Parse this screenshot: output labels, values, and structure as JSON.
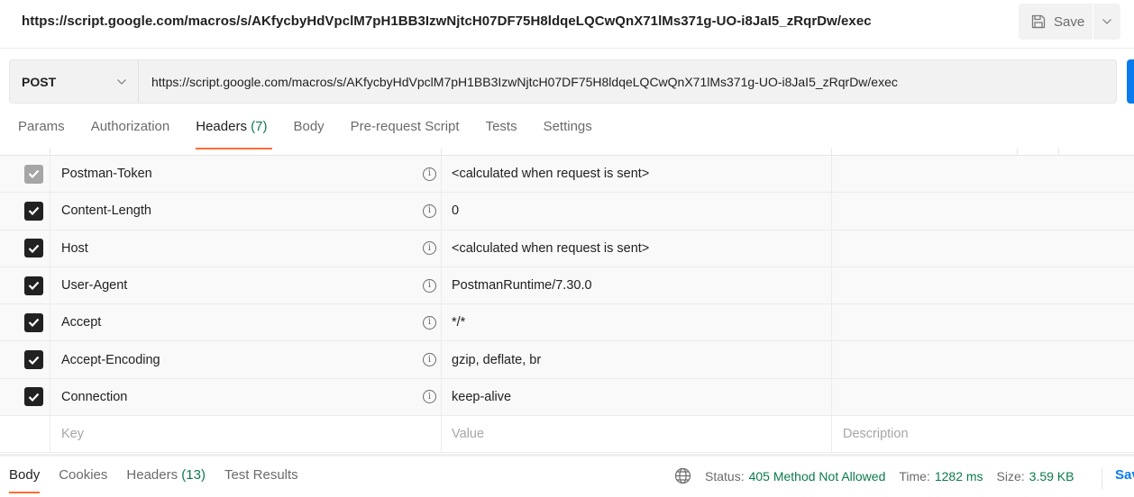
{
  "window": {
    "title_url": "https://script.google.com/macros/s/AKfycbyHdVpclM7pH1BB3IzwNjtcH07DF75H8ldqeLQCwQnX71lMs371g-UO-i8JaI5_zRqrDw/exec",
    "save_label": "Save",
    "save_icon": "floppy-disk-icon",
    "save_menu_icon": "chevron-down-icon"
  },
  "request": {
    "method": "POST",
    "method_icon": "chevron-down-icon",
    "url": "https://script.google.com/macros/s/AKfycbyHdVpclM7pH1BB3IzwNjtcH07DF75H8ldqeLQCwQnX71lMs371g-UO-i8JaI5_zRqrDw/exec"
  },
  "tabs": [
    {
      "label": "Params"
    },
    {
      "label": "Authorization"
    },
    {
      "label": "Headers",
      "count": "(7)",
      "active": true
    },
    {
      "label": "Body"
    },
    {
      "label": "Pre-request Script"
    },
    {
      "label": "Tests"
    },
    {
      "label": "Settings"
    }
  ],
  "headers_table": {
    "rows": [
      {
        "checked": true,
        "disabled": true,
        "key": "Postman-Token",
        "value": "<calculated when request is sent>",
        "description": ""
      },
      {
        "checked": true,
        "disabled": false,
        "key": "Content-Length",
        "value": "0",
        "description": ""
      },
      {
        "checked": true,
        "disabled": false,
        "key": "Host",
        "value": "<calculated when request is sent>",
        "description": ""
      },
      {
        "checked": true,
        "disabled": false,
        "key": "User-Agent",
        "value": "PostmanRuntime/7.30.0",
        "description": ""
      },
      {
        "checked": true,
        "disabled": false,
        "key": "Accept",
        "value": "*/*",
        "description": ""
      },
      {
        "checked": true,
        "disabled": false,
        "key": "Accept-Encoding",
        "value": "gzip, deflate, br",
        "description": ""
      },
      {
        "checked": true,
        "disabled": false,
        "key": "Connection",
        "value": "keep-alive",
        "description": ""
      }
    ],
    "new_row": {
      "key_placeholder": "Key",
      "value_placeholder": "Value",
      "description_placeholder": "Description"
    }
  },
  "response": {
    "tabs": [
      {
        "label": "Body",
        "active": true
      },
      {
        "label": "Cookies"
      },
      {
        "label": "Headers",
        "count": "(13)"
      },
      {
        "label": "Test Results"
      }
    ],
    "network_icon": "globe-icon",
    "status_label": "Status:",
    "status_value": "405 Method Not Allowed",
    "time_label": "Time:",
    "time_value": "1282 ms",
    "size_label": "Size:",
    "size_value": "3.59 KB",
    "save_response_label": "Save Response",
    "colors": {
      "status": "#0b7a4b",
      "link": "#097bed",
      "active_tab": "#ff6c37"
    }
  }
}
